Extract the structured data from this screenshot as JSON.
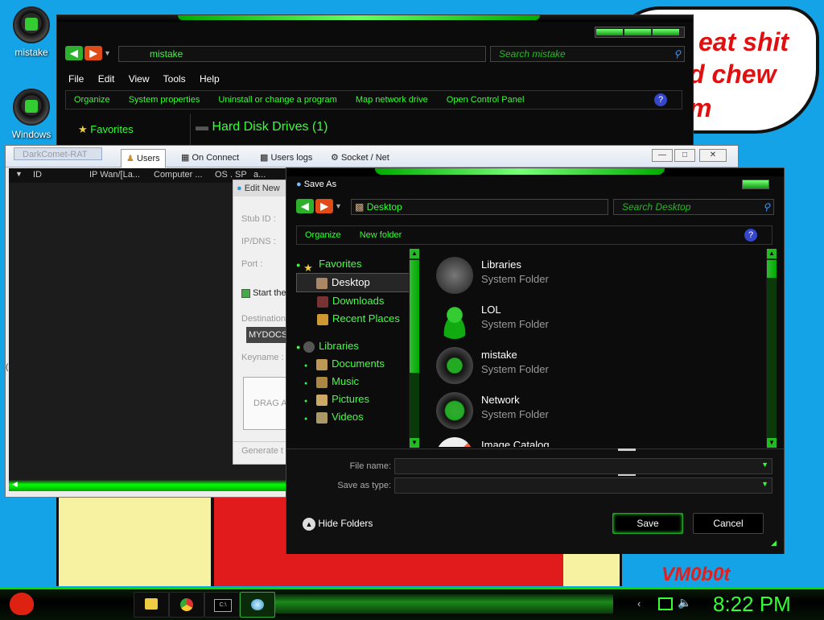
{
  "desktop": {
    "icons": [
      {
        "label": "mistake",
        "icon": "globe-icon"
      },
      {
        "label": "Windows",
        "icon": "globe-icon"
      }
    ],
    "bubble_lines": [
      "eat shit",
      "d chew",
      "m"
    ],
    "signature": "VM0b0t"
  },
  "explorer": {
    "address": "mistake",
    "search_placeholder": "Search mistake",
    "menu": [
      "File",
      "Edit",
      "View",
      "Tools",
      "Help"
    ],
    "commands": [
      "Organize",
      "System properties",
      "Uninstall or change a program",
      "Map network drive",
      "Open Control Panel"
    ],
    "sidebar": {
      "favorites": "Favorites"
    },
    "section_heading": "Hard Disk Drives (1)"
  },
  "rat": {
    "title": "DarkComet-RAT",
    "tabs": [
      "Users",
      "On Connect",
      "Users logs",
      "Socket / Net"
    ],
    "columns": [
      "ID",
      "IP Wan/[La...",
      "Computer ...",
      "OS . SP",
      "a..."
    ],
    "edit_panel": {
      "title": "Edit New",
      "labels": [
        "Stub ID :",
        "IP/DNS :",
        "Port :",
        "Start the",
        "Destination",
        "Keyname :",
        "DRAG A",
        "Generate t"
      ],
      "dest_value": "MYDOCS\\"
    }
  },
  "save_dialog": {
    "title": "Save As",
    "address": "Desktop",
    "search_placeholder": "Search Desktop",
    "commands": {
      "organize": "Organize",
      "new_folder": "New folder"
    },
    "tree": {
      "favorites": "Favorites",
      "favorite_items": [
        "Desktop",
        "Downloads",
        "Recent Places"
      ],
      "libraries": "Libraries",
      "library_items": [
        "Documents",
        "Music",
        "Pictures",
        "Videos"
      ]
    },
    "files": [
      {
        "name": "Libraries",
        "type": "System Folder"
      },
      {
        "name": "LOL",
        "type": "System Folder"
      },
      {
        "name": "mistake",
        "type": "System Folder"
      },
      {
        "name": "Network",
        "type": "System Folder"
      },
      {
        "name": "Image Catalog",
        "type": ""
      }
    ],
    "file_name_label": "File name:",
    "file_name_value": "",
    "save_type_label": "Save as type:",
    "save_type_value": "",
    "hide_folders": "Hide Folders",
    "save_label": "Save",
    "cancel_label": "Cancel"
  },
  "taskbar": {
    "clock": "8:22 PM",
    "items": [
      "folder-icon",
      "chrome-icon",
      "console-icon",
      "rat-icon"
    ]
  },
  "colors": {
    "accent": "#33ff33",
    "desktop": "#14a3e6"
  }
}
